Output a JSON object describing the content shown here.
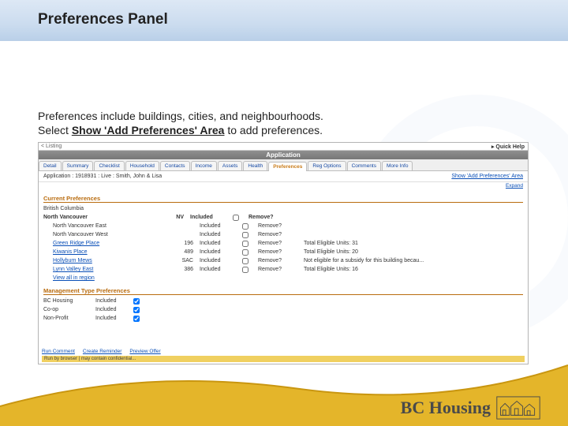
{
  "slide": {
    "title": "Preferences Panel",
    "intro_line1": "Preferences include buildings, cities, and neighbourhoods.",
    "intro_line2a": "Select ",
    "intro_line2b": "Show 'Add Preferences' Area",
    "intro_line2c": " to add preferences."
  },
  "app": {
    "title_bar": "Application",
    "back": "< Listing",
    "quick_help": "Quick Help",
    "tabs": [
      "Detail",
      "Summary",
      "Checklist",
      "Household",
      "Contacts",
      "Income",
      "Assets",
      "Health",
      "Preferences",
      "Reg Options",
      "Comments",
      "More Info"
    ],
    "active_tab_index": 8,
    "crumb": "Application : 1918931 : Live : Smith, John & Lisa",
    "show_link": "Show 'Add Preferences' Area",
    "expand": "Expand",
    "current_prefs_title": "Current Preferences",
    "bc_label": "British Columbia",
    "city": "North Vancouver",
    "city_code": "NV",
    "included": "Included",
    "remove": "Remove?",
    "rows": [
      {
        "name": "North Vancouver East",
        "code": "",
        "note": ""
      },
      {
        "name": "North Vancouver West",
        "code": "",
        "note": ""
      },
      {
        "name": "Green Ridge Place",
        "code": "196",
        "note": "Total Eligible Units: 31"
      },
      {
        "name": "Kiwanis Place",
        "code": "489",
        "note": "Total Eligible Units: 20"
      },
      {
        "name": "Hollyburn Mews",
        "code": "SAC",
        "note": "Not eligible for a subsidy for this building becau..."
      },
      {
        "name": "Lynn Valley East",
        "code": "386",
        "note": "Total Eligible Units: 16"
      },
      {
        "name": "View all in region",
        "code": "",
        "note": ""
      }
    ],
    "mgmt_title": "Management Type Preferences",
    "mgmt_rows": [
      {
        "name": "BC Housing",
        "val": "Included",
        "checked": true
      },
      {
        "name": "Co-op",
        "val": "Included",
        "checked": true
      },
      {
        "name": "Non-Profit",
        "val": "Included",
        "checked": true
      }
    ],
    "footer_links": [
      "Run Comment",
      "Create Reminder",
      "Preview Offer"
    ],
    "footer_bar": "Run by browser | may contain confidential..."
  },
  "logo": {
    "text": "BC Housing"
  }
}
